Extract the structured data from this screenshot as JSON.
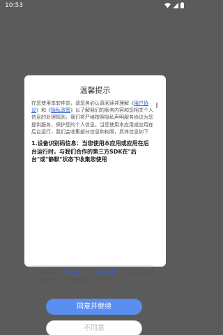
{
  "status_bar": {
    "time": "10:53",
    "icons": [
      "wifi-icon",
      "signal-icon",
      "battery-icon"
    ]
  },
  "dialog": {
    "title": "温馨提示",
    "intro": {
      "part1": "在您使用本软件前，请您务必认真阅读并理解《",
      "link1": "用户协议",
      "part2": "》和《",
      "link2": "隐私政策",
      "part3": "》以了解我们的服务内容和您相关个人信息的处理规则，我们将严格按照隐私声明服务协议为您提供服务，保护您的个人信息。当您使用本应用或应用在后台运行，我们会收集部分信息和权限，具体信息如下"
    },
    "clause": "1.设备识别码信息：当您使用本应用或应用在后台运行时，与我们合作的第三方SDK在\"后台\"或\"静默\"状态下收集您使用",
    "agree": {
      "part1": "如果您同意《",
      "link1": "用户协议",
      "part2": "》和《",
      "link2": "隐私政策",
      "part3": "》，请点击\"同意隐私政策并继续\"开始使用我们的产品。"
    },
    "accept_label": "同意并继续",
    "decline_label": "不同意"
  },
  "colors": {
    "overlay": "#5b5b5b",
    "accent": "#5a8ef0",
    "link": "#2f5fd6"
  }
}
